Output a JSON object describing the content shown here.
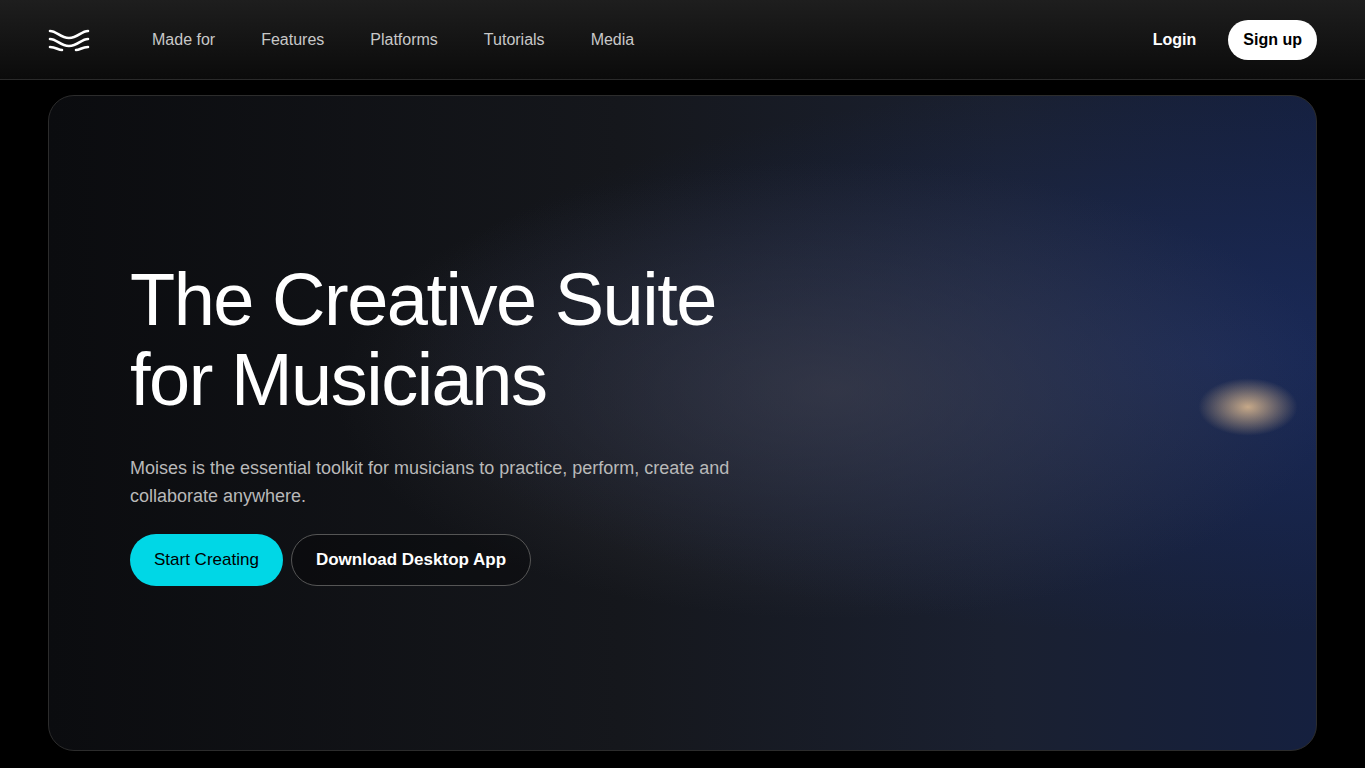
{
  "nav": {
    "links": [
      "Made for",
      "Features",
      "Platforms",
      "Tutorials",
      "Media"
    ],
    "login": "Login",
    "signup": "Sign up"
  },
  "hero": {
    "title": [
      "The Creative Suite",
      "for Musicians"
    ],
    "subtitle": "Moises is the essential toolkit for musicians to practice, perform, create and collaborate anywhere.",
    "buttons": [
      {
        "label": "Start Creating",
        "kind": "primary"
      },
      {
        "label": "Download Desktop App",
        "kind": "outline"
      }
    ]
  }
}
